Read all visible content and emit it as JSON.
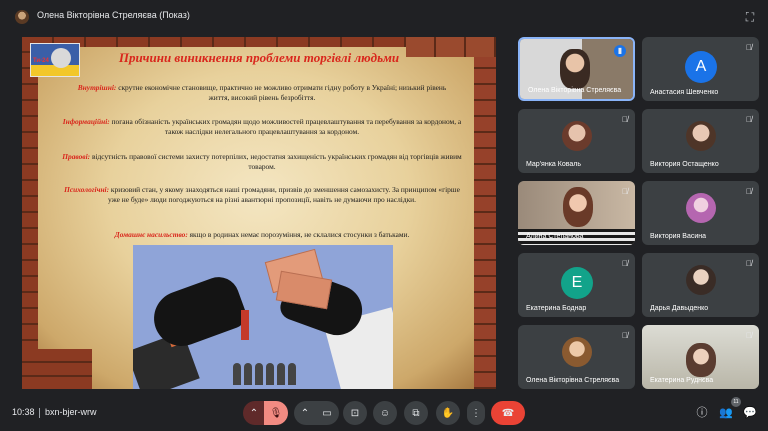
{
  "window": {
    "title": "Олена Вікторівна Стреляєва (Показ)"
  },
  "slide": {
    "title": "Причини виникнення проблеми торгівлі людьми",
    "logo_text": "Ти-24",
    "paragraphs": [
      {
        "label": "Внутрішні:",
        "text": " скрутне економічне становище, практично не можливо отримати гідну роботу в Україні; низький рівень життя, високий рівень безробіття."
      },
      {
        "label": "Інформаційні:",
        "text": " погана обізнаність українських громадян щодо можливостей працевлаштування та перебування за кордоном, а також наслідки нелегального працевлаштування за кордоном."
      },
      {
        "label": "Правові:",
        "text": " відсутність правової системи захисту потерпілих, недостатня захищеність українських громадян від торгівців живим товаром."
      },
      {
        "label": "Психологічні:",
        "text": " кризовий стан, у якому знаходяться наші громадяни, призвів до зменшення самозахисту. За принципом «гірше уже не буде» люди погоджуються на різні авантюрні пропозиції, навіть не думаючи про наслідки."
      },
      {
        "label": "Домашнє насильство:",
        "text": " якщо в родинах немає порозуміння, не склалися стосунки з батьками."
      }
    ]
  },
  "participants": [
    {
      "name": "Олена Вікторівна Стреляєва",
      "type": "video",
      "speaking": true
    },
    {
      "name": "Анастасия Шевченко",
      "type": "avatar",
      "initial": "А",
      "color": "#1a73e8"
    },
    {
      "name": "Мар'янка Коваль",
      "type": "photo"
    },
    {
      "name": "Виктория Остащенко",
      "type": "photo"
    },
    {
      "name": "Алина Степанова",
      "type": "video"
    },
    {
      "name": "Виктория Васина",
      "type": "photo"
    },
    {
      "name": "Екатерина Боднар",
      "type": "avatar",
      "initial": "Е",
      "color": "#12a38a"
    },
    {
      "name": "Дарья Давыденко",
      "type": "photo"
    },
    {
      "name": "Олена Вікторівна Стреляєва",
      "type": "photo"
    },
    {
      "name": "Екатерина Руднєва",
      "type": "video"
    }
  ],
  "bottom": {
    "time": "10:38",
    "meeting_code": "bxn-bjer-wrw",
    "participants_count": "11"
  },
  "colors": {
    "background": "#202124",
    "tile": "#3c4043",
    "end_call": "#ea4335",
    "mic_off": "#f28b82",
    "speaking_border": "#8ab4f8"
  }
}
